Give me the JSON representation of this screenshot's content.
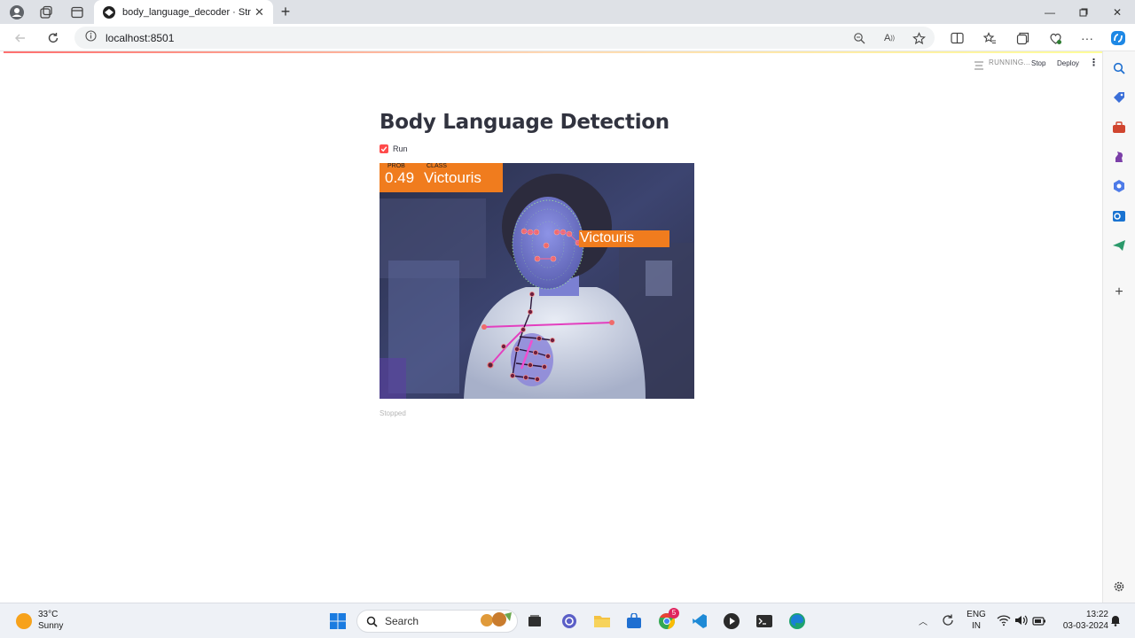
{
  "browser": {
    "tab_title": "body_language_decoder · Stream",
    "url": "localhost:8501"
  },
  "streamlit": {
    "status": "RUNNING...",
    "stop_label": "Stop",
    "deploy_label": "Deploy",
    "title": "Body Language Detection",
    "run_label": "Run",
    "run_checked": true,
    "stopped_text": "Stopped"
  },
  "video_overlay": {
    "prob_header": "PROB",
    "class_header": "CLASS",
    "prob_value": "0.49",
    "class_value": "Victouris",
    "face_label": "Victouris",
    "overlay_color": "#f07c1e"
  },
  "taskbar": {
    "temperature": "33°C",
    "weather": "Sunny",
    "search_label": "Search",
    "lang_line1": "ENG",
    "lang_line2": "IN",
    "time": "13:22",
    "date": "03-03-2024",
    "chrome_badge": "5"
  },
  "colors": {
    "accent": "#ff4b4b",
    "title": "#31333f"
  }
}
